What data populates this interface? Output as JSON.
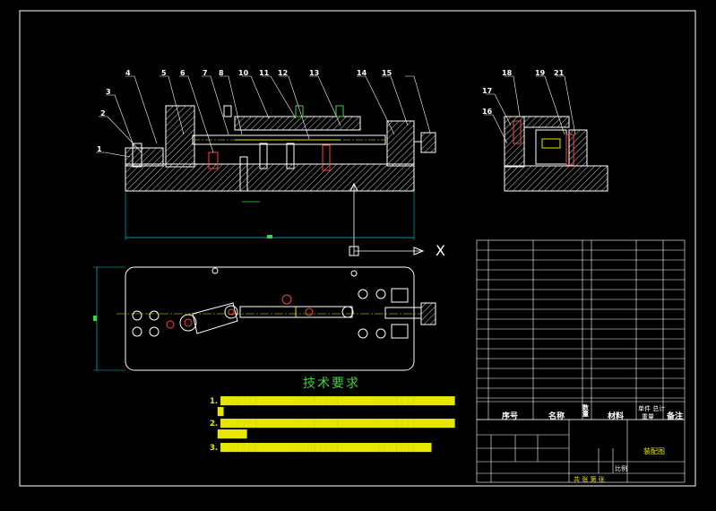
{
  "balloons": {
    "front": [
      "4",
      "3",
      "2",
      "1",
      "5",
      "6",
      "7",
      "8",
      "10",
      "11",
      "12",
      "13",
      "14",
      "15"
    ],
    "side": [
      "18",
      "17",
      "16",
      "19",
      "21"
    ]
  },
  "dimension_axis_label": "X",
  "technical_requirements": {
    "title": "技术要求"
  },
  "parts_table": {
    "header": {
      "seq": "序号",
      "name": "名称",
      "qty": "数量",
      "material": "材料",
      "weight": "单件 总计",
      "weight2": "重量",
      "remark": "备注"
    }
  },
  "title_block": {
    "drawing_name": "装配图",
    "scale_label": "比例",
    "sheet_label": "共 张 第 张"
  },
  "colors": {
    "frame": "#ffffff",
    "outline": "#ffffff",
    "hatch": "#ffffff",
    "centerline": "#e6e600",
    "hidden": "#ff4040",
    "dimension": "#00c8c8",
    "title_text": "#3fd23f",
    "note_text": "#e6e600"
  }
}
